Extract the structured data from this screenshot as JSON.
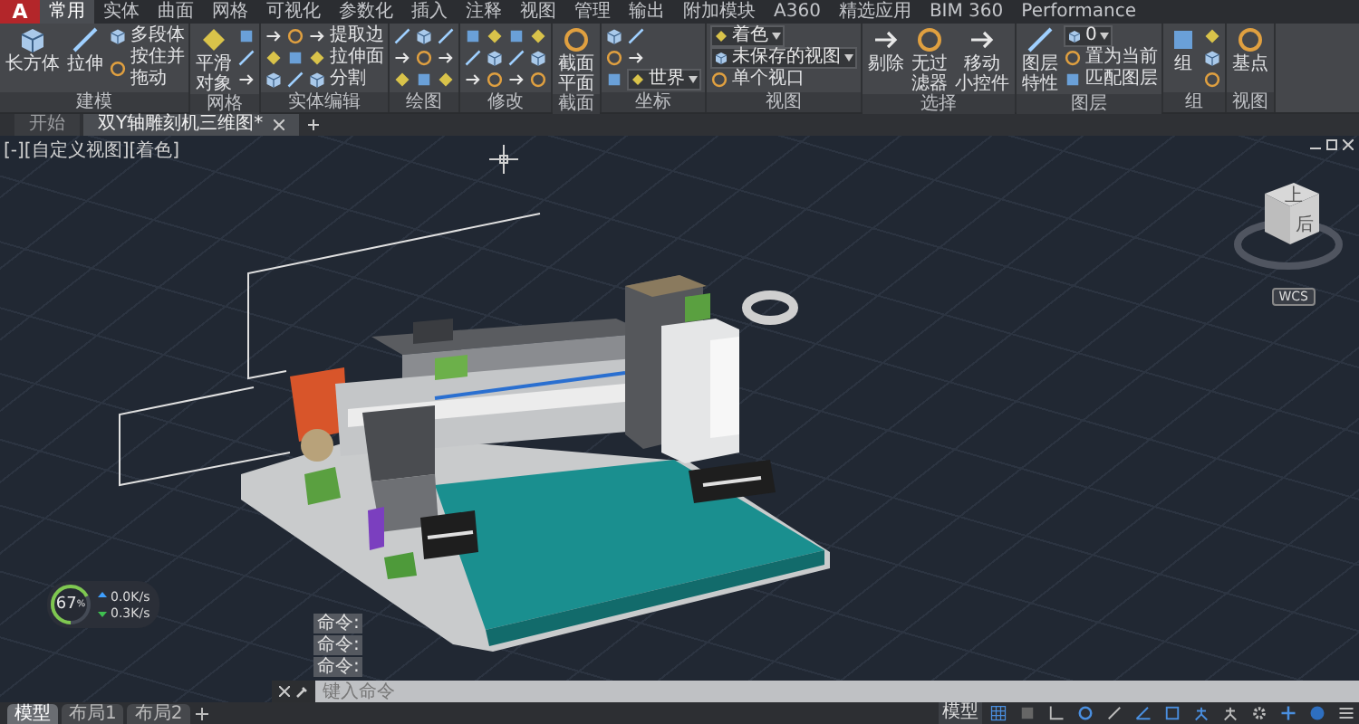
{
  "app_button": "A",
  "ribbon_tabs": [
    {
      "label": "常用",
      "selected": true
    },
    {
      "label": "实体",
      "selected": false
    },
    {
      "label": "曲面",
      "selected": false
    },
    {
      "label": "网格",
      "selected": false
    },
    {
      "label": "可视化",
      "selected": false
    },
    {
      "label": "参数化",
      "selected": false
    },
    {
      "label": "插入",
      "selected": false
    },
    {
      "label": "注释",
      "selected": false
    },
    {
      "label": "视图",
      "selected": false
    },
    {
      "label": "管理",
      "selected": false
    },
    {
      "label": "输出",
      "selected": false
    },
    {
      "label": "附加模块",
      "selected": false
    },
    {
      "label": "A360",
      "selected": false
    },
    {
      "label": "精选应用",
      "selected": false
    },
    {
      "label": "BIM 360",
      "selected": false
    },
    {
      "label": "Performance",
      "selected": false
    }
  ],
  "ribbon_panels": [
    {
      "title": "建模",
      "columns": [
        {
          "kind": "large",
          "label": "长方体"
        },
        {
          "kind": "large",
          "label": "拉伸"
        },
        {
          "kind": "stack",
          "items": [
            {
              "kind": "small",
              "label": "多段体"
            },
            {
              "kind": "small",
              "lines": [
                "按住并",
                "拖动"
              ]
            }
          ]
        }
      ]
    },
    {
      "title": "网格",
      "columns": [
        {
          "kind": "large",
          "lines": [
            "平滑",
            "对象"
          ]
        },
        {
          "kind": "stack",
          "items": [
            {
              "kind": "icon"
            },
            {
              "kind": "icon"
            },
            {
              "kind": "icon"
            }
          ]
        }
      ]
    },
    {
      "title": "实体编辑",
      "columns": [
        {
          "kind": "stack",
          "items": [
            {
              "kind": "icon"
            },
            {
              "kind": "icon"
            },
            {
              "kind": "icon"
            }
          ]
        },
        {
          "kind": "stack",
          "items": [
            {
              "kind": "icon"
            },
            {
              "kind": "icon"
            },
            {
              "kind": "icon"
            }
          ]
        },
        {
          "kind": "stack",
          "items": [
            {
              "kind": "small",
              "label": "提取边"
            },
            {
              "kind": "small",
              "label": "拉伸面"
            },
            {
              "kind": "small",
              "label": "分割"
            }
          ]
        }
      ]
    },
    {
      "title": "绘图",
      "columns": [
        {
          "kind": "stack",
          "items": [
            {
              "kind": "icon"
            },
            {
              "kind": "icon"
            },
            {
              "kind": "icon"
            }
          ]
        },
        {
          "kind": "stack",
          "items": [
            {
              "kind": "icon"
            },
            {
              "kind": "icon"
            },
            {
              "kind": "icon"
            }
          ]
        },
        {
          "kind": "stack",
          "items": [
            {
              "kind": "icon"
            },
            {
              "kind": "icon"
            },
            {
              "kind": "icon"
            }
          ]
        }
      ]
    },
    {
      "title": "修改",
      "columns": [
        {
          "kind": "stack",
          "items": [
            {
              "kind": "icon"
            },
            {
              "kind": "icon"
            },
            {
              "kind": "icon"
            }
          ]
        },
        {
          "kind": "stack",
          "items": [
            {
              "kind": "icon"
            },
            {
              "kind": "icon"
            },
            {
              "kind": "icon"
            }
          ]
        },
        {
          "kind": "stack",
          "items": [
            {
              "kind": "icon"
            },
            {
              "kind": "icon"
            },
            {
              "kind": "icon"
            }
          ]
        },
        {
          "kind": "stack",
          "items": [
            {
              "kind": "icon"
            },
            {
              "kind": "icon"
            },
            {
              "kind": "icon"
            }
          ]
        }
      ]
    },
    {
      "title": "截面",
      "columns": [
        {
          "kind": "large",
          "lines": [
            "截面",
            "平面"
          ]
        }
      ]
    },
    {
      "title": "坐标",
      "columns": [
        {
          "kind": "stack",
          "items": [
            {
              "kind": "icon"
            },
            {
              "kind": "icon"
            },
            {
              "kind": "icon"
            }
          ]
        },
        {
          "kind": "stack",
          "items": [
            {
              "kind": "icon"
            },
            {
              "kind": "icon"
            },
            {
              "kind": "dropdown",
              "value": "世界"
            }
          ]
        }
      ]
    },
    {
      "title": "视图",
      "columns": [
        {
          "kind": "stack",
          "items": [
            {
              "kind": "dropdown",
              "value": "着色"
            },
            {
              "kind": "dropdown",
              "value": "未保存的视图"
            },
            {
              "kind": "small",
              "label": "单个视口"
            }
          ]
        }
      ]
    },
    {
      "title": "选择",
      "columns": [
        {
          "kind": "large",
          "label": "剔除"
        },
        {
          "kind": "large",
          "lines": [
            "无过",
            "滤器"
          ]
        },
        {
          "kind": "large",
          "lines": [
            "移动",
            "小控件"
          ]
        }
      ]
    },
    {
      "title": "图层",
      "columns": [
        {
          "kind": "large",
          "lines": [
            "图层",
            "特性"
          ]
        },
        {
          "kind": "stack",
          "items": [
            {
              "kind": "dropdown",
              "value": "0"
            },
            {
              "kind": "small",
              "label": "置为当前"
            },
            {
              "kind": "small",
              "label": "匹配图层"
            }
          ]
        }
      ]
    },
    {
      "title": "组",
      "columns": [
        {
          "kind": "large",
          "label": "组"
        },
        {
          "kind": "stack",
          "items": [
            {
              "kind": "icon"
            },
            {
              "kind": "icon"
            },
            {
              "kind": "icon"
            }
          ]
        }
      ]
    },
    {
      "title": "视图",
      "columns": [
        {
          "kind": "large",
          "label": "基点"
        }
      ]
    }
  ],
  "document_tabs": [
    {
      "label": "开始",
      "selected": false
    },
    {
      "label": "双Y轴雕刻机三维图*",
      "selected": true
    }
  ],
  "viewport": {
    "label": "[-][自定义视图][着色]",
    "viewcube": {
      "top": "上",
      "right": "后",
      "wcs": "WCS"
    }
  },
  "network_meter": {
    "value": "67",
    "unit": "%",
    "level": 0.67,
    "upload": "0.0K/s",
    "download": "0.3K/s"
  },
  "command_line": {
    "history": [
      "命令:",
      "命令:",
      "命令:"
    ],
    "placeholder": "键入命令"
  },
  "layout_tabs": [
    {
      "label": "模型",
      "selected": true
    },
    {
      "label": "布局1",
      "selected": false
    },
    {
      "label": "布局2",
      "selected": false
    }
  ],
  "status_bar": {
    "space": "模型"
  }
}
